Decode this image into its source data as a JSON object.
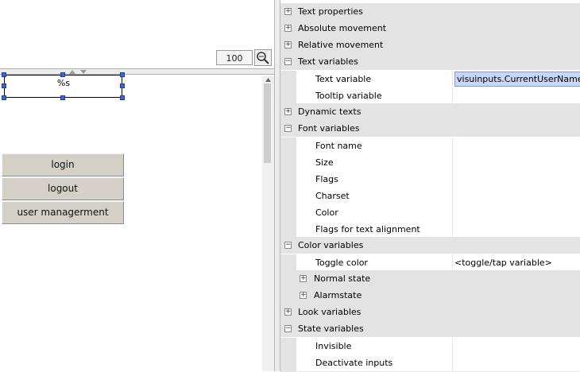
{
  "editor": {
    "zoom_value": "100",
    "selected_element_text": "%s",
    "buttons": [
      "login",
      "logout",
      "user managerment"
    ]
  },
  "properties": {
    "rows": [
      {
        "kind": "group",
        "expander": "+",
        "label": "Text properties"
      },
      {
        "kind": "group",
        "expander": "+",
        "label": "Absolute movement"
      },
      {
        "kind": "group",
        "expander": "+",
        "label": "Relative movement"
      },
      {
        "kind": "group",
        "expander": "−",
        "label": "Text variables"
      },
      {
        "kind": "item",
        "label": "Text variable",
        "value": "visuinputs.CurrentUserName"
      },
      {
        "kind": "item",
        "label": "Tooltip variable",
        "value": ""
      },
      {
        "kind": "group",
        "expander": "+",
        "label": "Dynamic texts"
      },
      {
        "kind": "group",
        "expander": "−",
        "label": "Font variables"
      },
      {
        "kind": "item",
        "label": "Font name",
        "value": ""
      },
      {
        "kind": "item",
        "label": "Size",
        "value": ""
      },
      {
        "kind": "item",
        "label": "Flags",
        "value": ""
      },
      {
        "kind": "item",
        "label": "Charset",
        "value": ""
      },
      {
        "kind": "item",
        "label": "Color",
        "value": ""
      },
      {
        "kind": "item",
        "label": "Flags for text alignment",
        "value": ""
      },
      {
        "kind": "group",
        "expander": "−",
        "label": "Color variables"
      },
      {
        "kind": "item",
        "label": "Toggle color",
        "value": "<toggle/tap variable>"
      },
      {
        "kind": "subgroup",
        "expander": "+",
        "label": "Normal state"
      },
      {
        "kind": "subgroup",
        "expander": "+",
        "label": "Alarmstate"
      },
      {
        "kind": "group",
        "expander": "+",
        "label": "Look variables"
      },
      {
        "kind": "group",
        "expander": "−",
        "label": "State variables"
      },
      {
        "kind": "item",
        "label": "Invisible",
        "value": ""
      },
      {
        "kind": "item",
        "label": "Deactivate inputs",
        "value": ""
      }
    ]
  }
}
